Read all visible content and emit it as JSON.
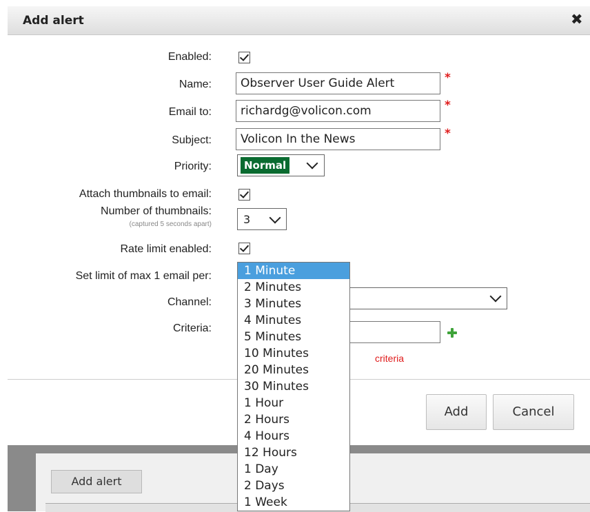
{
  "dialog": {
    "title": "Add alert",
    "close_symbol": "✖",
    "close_icon": "close-icon"
  },
  "form": {
    "enabled_label": "Enabled:",
    "enabled_checked": true,
    "name_label": "Name:",
    "name_value": "Observer User Guide Alert",
    "email_label": "Email to:",
    "email_value": "richardg@volicon.com",
    "subject_label": "Subject:",
    "subject_value": "Volicon In the News",
    "required_marker": "*",
    "priority_label": "Priority:",
    "priority_value": "Normal",
    "priority_color": "#0a6b30",
    "attach_label": "Attach thumbnails to email:",
    "attach_checked": true,
    "num_thumbs_label": "Number of thumbnails:",
    "num_thumbs_note": "(captured 5 seconds apart)",
    "num_thumbs_value": "3",
    "rate_limit_label": "Rate limit enabled:",
    "rate_limit_checked": true,
    "set_limit_label": "Set limit of max 1 email per:",
    "channel_label": "Channel:",
    "channel_value": "",
    "criteria_label": "Criteria:",
    "criteria_value": "",
    "criteria_message_visible": "criteria"
  },
  "rate_dropdown": {
    "selected": "1 Minute",
    "highlight_color": "#4a9fde",
    "options": [
      "1 Minute",
      "2 Minutes",
      "3 Minutes",
      "4 Minutes",
      "5 Minutes",
      "10 Minutes",
      "20 Minutes",
      "30 Minutes",
      "1 Hour",
      "2 Hours",
      "4 Hours",
      "12 Hours",
      "1 Day",
      "2 Days",
      "1 Week"
    ]
  },
  "buttons": {
    "add_label": "Add",
    "cancel_label": "Cancel"
  },
  "background": {
    "add_alert_button": "Add alert"
  }
}
